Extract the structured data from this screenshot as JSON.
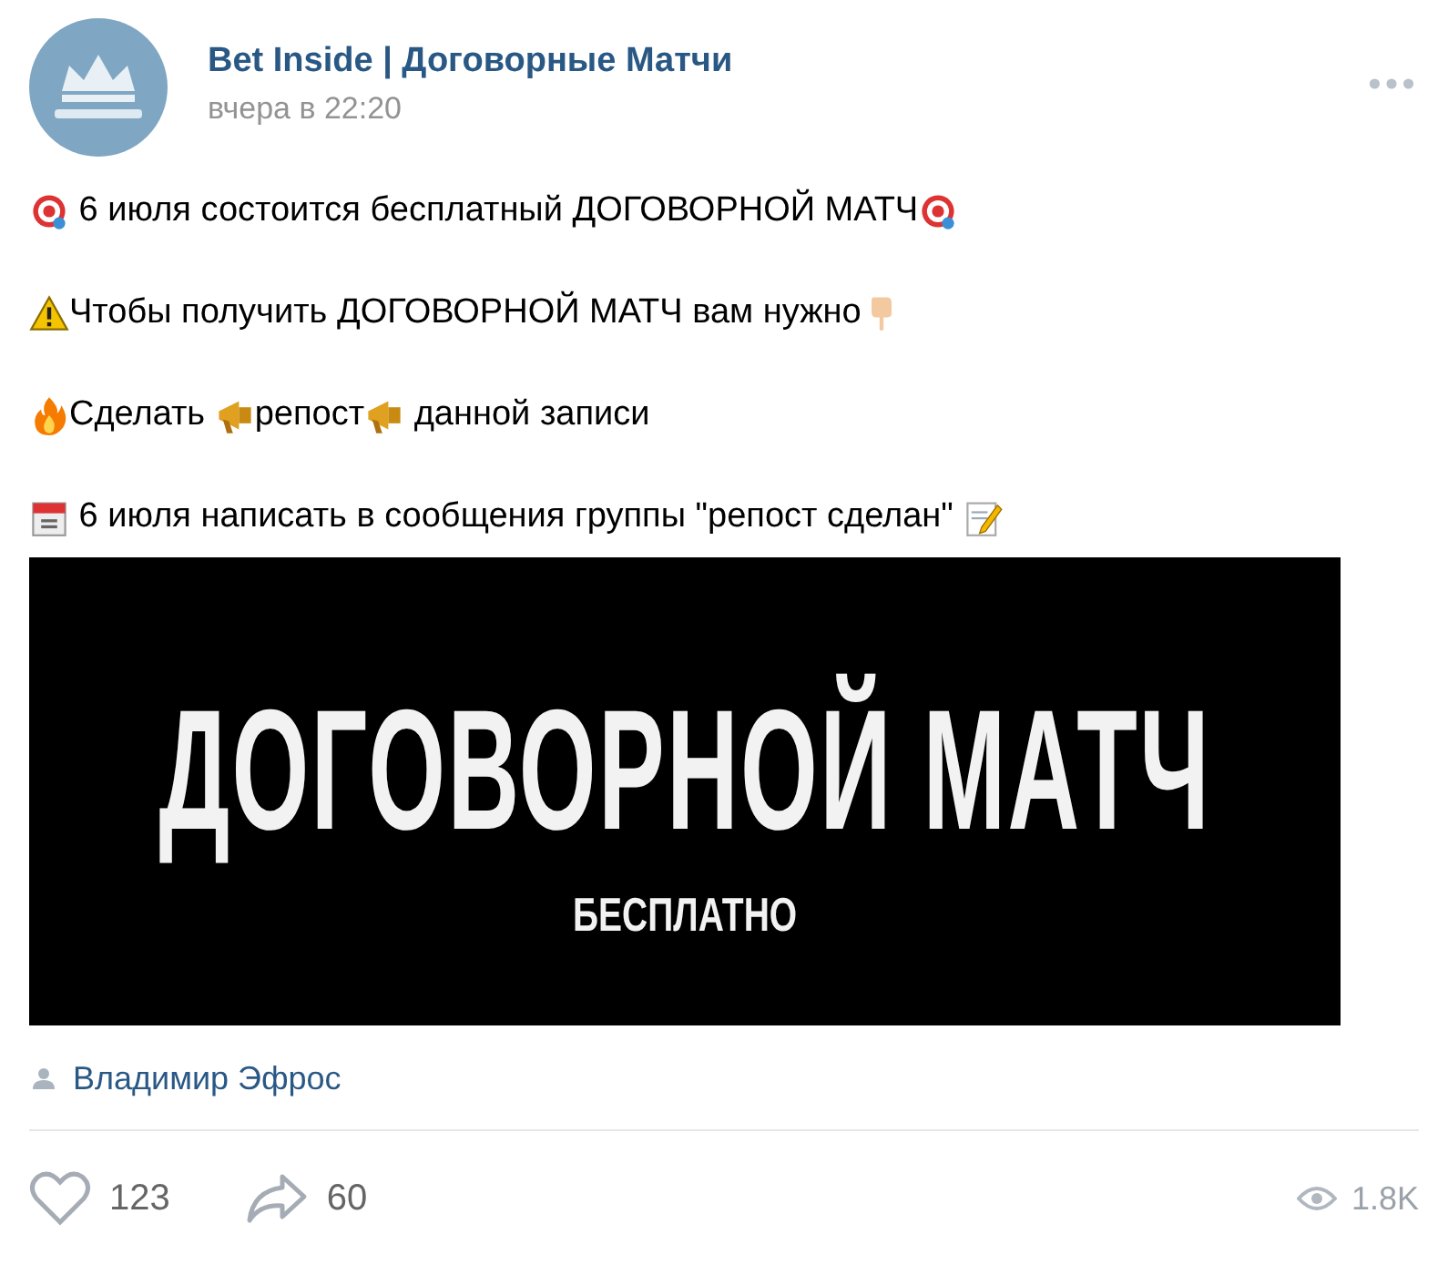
{
  "post": {
    "author": "Bet Inside | Договорные Матчи",
    "time": "вчера в 22:20",
    "lines": [
      [
        {
          "kind": "target"
        },
        {
          "kind": "text",
          "text": " 6 июля состоится бесплатный ДОГОВОРНОЙ МАТЧ"
        },
        {
          "kind": "target"
        }
      ],
      [
        {
          "kind": "warning"
        },
        {
          "kind": "text",
          "text": "Чтобы получить ДОГОВОРНОЙ МАТЧ вам нужно"
        },
        {
          "kind": "finger"
        }
      ],
      [
        {
          "kind": "fire"
        },
        {
          "kind": "text",
          "text": "Сделать "
        },
        {
          "kind": "horn"
        },
        {
          "kind": "text",
          "text": "репост"
        },
        {
          "kind": "horn"
        },
        {
          "kind": "text",
          "text": " данной записи"
        }
      ],
      [
        {
          "kind": "calendar"
        },
        {
          "kind": "text",
          "text": " 6 июля написать в сообщения группы \"репост сделан\" "
        },
        {
          "kind": "pencil"
        }
      ]
    ],
    "banner": {
      "title": "ДОГОВОРНОЙ МАТЧ",
      "subtitle": "БЕСПЛАТНО"
    },
    "signer": "Владимир Эфрос",
    "likes": "123",
    "shares": "60",
    "views": "1.8K"
  }
}
